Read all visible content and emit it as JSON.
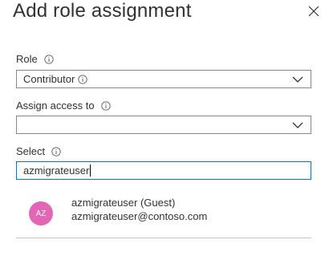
{
  "dialog": {
    "title": "Add role assignment"
  },
  "role": {
    "label": "Role",
    "value": "Contributor"
  },
  "assign_access": {
    "label": "Assign access to",
    "value": ""
  },
  "select": {
    "label": "Select",
    "value": "azmigrateuser"
  },
  "result": {
    "initials": "AZ",
    "name": "azmigrateuser (Guest)",
    "email": "azmigrateuser@contoso.com",
    "avatar_color": "#e366b5"
  },
  "colors": {
    "focus_border": "#0078d4",
    "border": "#8a8886",
    "text": "#323130"
  },
  "icons": {
    "close": "close-icon",
    "info": "info-icon",
    "dropdown": "chevron-down-icon"
  }
}
